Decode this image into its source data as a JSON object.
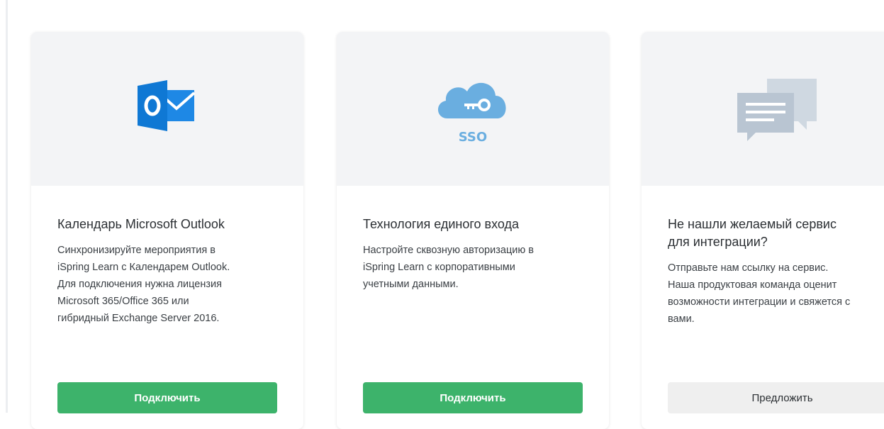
{
  "cards": [
    {
      "icon": "outlook-icon",
      "title": "Календарь Microsoft Outlook",
      "description_lines": [
        "Синхронизируйте мероприятия в",
        "iSpring Learn с Календарем Outlook.",
        "Для подключения нужна лицензия",
        "Microsoft 365/Office 365 или",
        "гибридный Exchange Server 2016."
      ],
      "button_label": "Подключить"
    },
    {
      "icon": "sso-cloud-key-icon",
      "icon_text": "SSO",
      "title": "Технология единого входа",
      "description_lines": [
        "Настройте сквозную авторизацию в",
        "iSpring Learn с корпоративными",
        "учетными данными."
      ],
      "button_label": "Подключить"
    },
    {
      "icon": "chat-bubbles-icon",
      "title_lines": [
        "Не нашли желаемый сервис",
        "для интеграции?"
      ],
      "description_lines": [
        "Отправьте нам ссылку на сервис.",
        "Наша продуктовая команда оценит",
        "возможности интеграции и свяжется с",
        "вами."
      ],
      "button_label": "Предложить"
    }
  ],
  "colors": {
    "accent_green": "#3db36b",
    "outlook_blue": "#0f78d4",
    "sso_cloud": "#6aaee0",
    "chat_gray": "#b9c5d2"
  }
}
